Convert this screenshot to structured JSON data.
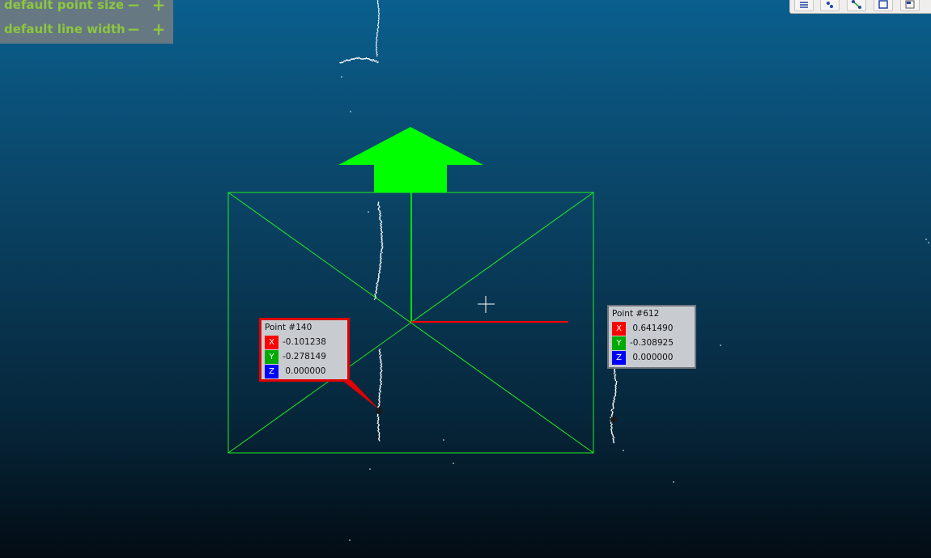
{
  "options_panel": {
    "point_size_label": "default point size",
    "line_width_label": "default line width",
    "minus": "−",
    "plus": "+"
  },
  "toolbar": {
    "buttons": [
      "list-icon",
      "point-pick-icon",
      "segment-pick-icon",
      "box-select-icon",
      "window-icon"
    ]
  },
  "labels": [
    {
      "title": "Point #140",
      "x_label": "X",
      "x": "-0.101238",
      "y_label": "Y",
      "y": "-0.278149",
      "z_label": "Z",
      "z": " 0.000000",
      "selected": true
    },
    {
      "title": "Point #612",
      "x_label": "X",
      "x": " 0.641490",
      "y_label": "Y",
      "y": "-0.308925",
      "z_label": "Z",
      "z": " 0.000000",
      "selected": false
    }
  ],
  "colors": {
    "accent_text": "#8dc63f",
    "bbox": "#22ee22",
    "axis_x": "#ff0000",
    "axis_y": "#00dd00",
    "axis_z": "#0000ff",
    "up_arrow": "#00ff00"
  }
}
